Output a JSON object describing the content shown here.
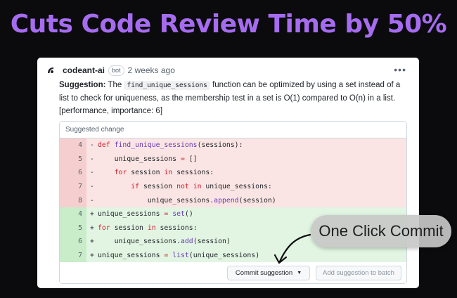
{
  "headline": "Cuts Code Review Time by 50%",
  "comment": {
    "author": "codeant-ai",
    "badge": "bot",
    "timestamp": "2 weeks ago",
    "suggestion_label": "Suggestion:",
    "text_before": "The",
    "inline_code": "find_unique_sessions",
    "text_after": "function can be optimized by using a set instead of a list to check for uniqueness, as the membership test in a set is O(1) compared to O(n) in a list. [performance, importance: 6]"
  },
  "suggested_change": {
    "header": "Suggested change",
    "removed": [
      {
        "line": "4",
        "sign": "-",
        "code": "def find_unique_sessions(sessions):"
      },
      {
        "line": "5",
        "sign": "-",
        "code": "    unique_sessions = []"
      },
      {
        "line": "6",
        "sign": "-",
        "code": "    for session in sessions:"
      },
      {
        "line": "7",
        "sign": "-",
        "code": "        if session not in unique_sessions:"
      },
      {
        "line": "8",
        "sign": "-",
        "code": "            unique_sessions.append(session)"
      }
    ],
    "added": [
      {
        "line": "4",
        "sign": "+",
        "code": "unique_sessions = set()"
      },
      {
        "line": "5",
        "sign": "+",
        "code": "for session in sessions:"
      },
      {
        "line": "6",
        "sign": "+",
        "code": "    unique_sessions.add(session)"
      },
      {
        "line": "7",
        "sign": "+",
        "code": "unique_sessions = list(unique_sessions)"
      }
    ],
    "commit_button": "Commit suggestion",
    "batch_button": "Add suggestion to batch"
  },
  "callout": "One Click Commit",
  "colors": {
    "headline": "#a66cf0",
    "deleted_bg": "#fbe5e4",
    "added_bg": "#e2f5e3"
  }
}
